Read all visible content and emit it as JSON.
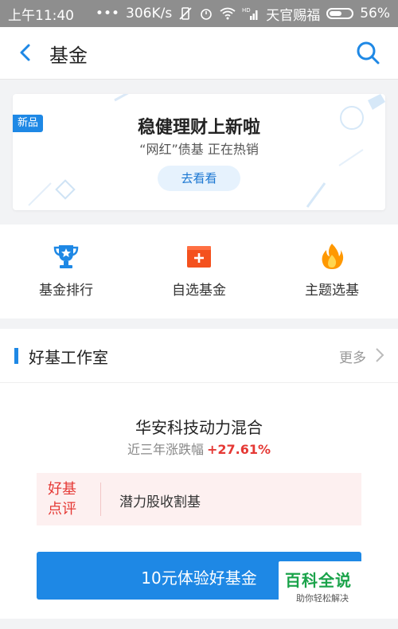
{
  "status_bar": {
    "time": "上午11:40",
    "network_speed": "306K/s",
    "carrier": "天官赐福",
    "battery": "56%",
    "battery_level": 0.56,
    "signal_label": "HD"
  },
  "header": {
    "title": "基金"
  },
  "banner": {
    "badge": "新品",
    "title": "稳健理财上新啦",
    "subtitle": "“网红”债基  正在热销",
    "button_label": "去看看"
  },
  "shortcuts": [
    {
      "label": "基金排行",
      "icon": "trophy-icon",
      "color": "#1e88e5"
    },
    {
      "label": "自选基金",
      "icon": "add-favorite-icon",
      "color": "#f4511e"
    },
    {
      "label": "主题选基",
      "icon": "flame-icon",
      "color": "#ff9800"
    }
  ],
  "studio": {
    "title": "好基工作室",
    "more": "更多",
    "fund_name": "华安科技动力混合",
    "perf_label": "近三年涨跌幅",
    "perf_value": "+27.61%",
    "review_label": "好基点评",
    "review_text": "潜力股收割基",
    "cta": "10元体验好基金"
  },
  "watermark": {
    "title": "百科全说",
    "subtitle": "助你轻松解决"
  },
  "colors": {
    "accent": "#1e88e5",
    "up": "#e53935",
    "status_bar": "#8e8e8e"
  }
}
